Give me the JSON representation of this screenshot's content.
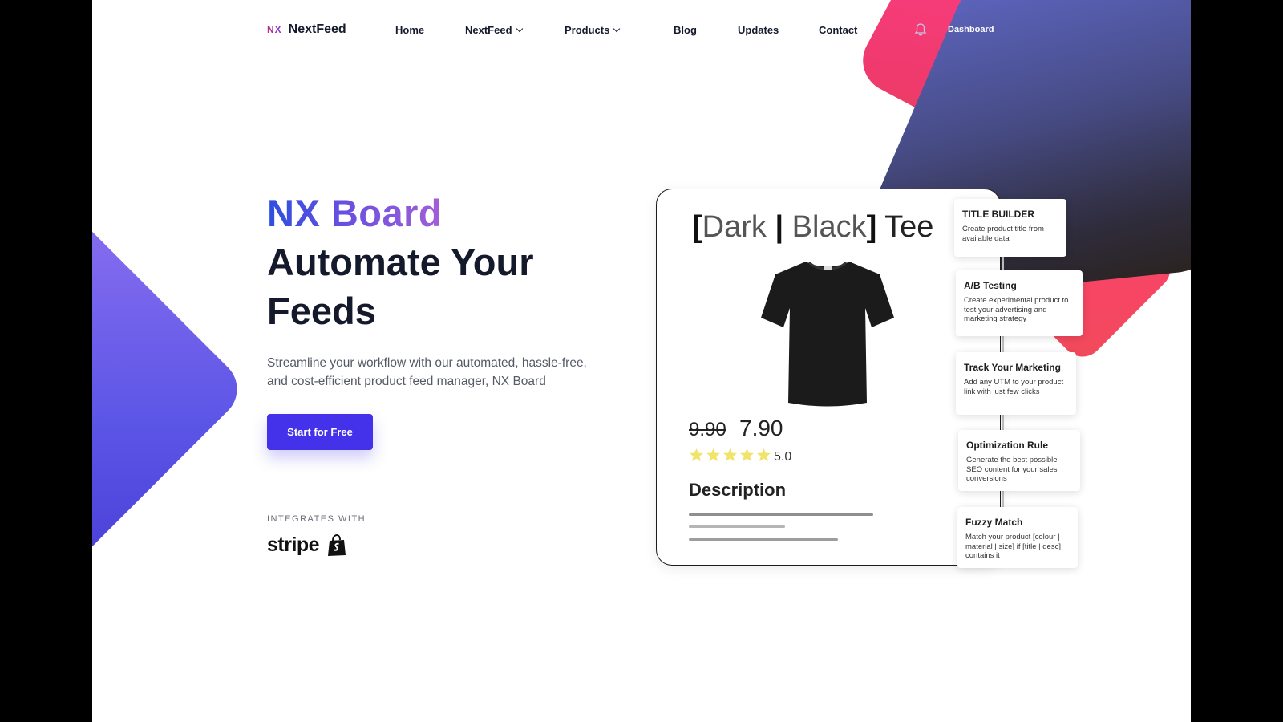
{
  "nav": {
    "logo_mark": "NX",
    "logo_text": "NextFeed",
    "items": [
      {
        "label": "Home"
      },
      {
        "label": "NextFeed"
      },
      {
        "label": "Products"
      },
      {
        "label": "Blog"
      },
      {
        "label": "Updates"
      },
      {
        "label": "Contact"
      }
    ],
    "dashboard_label": "Dashboard"
  },
  "hero": {
    "title_accent": "NX Board",
    "title_main": "Automate Your Feeds",
    "description": "Streamline your workflow with our automated, hassle-free, and cost-efficient product feed manager, NX Board",
    "cta_label": "Start for Free",
    "integrates_label": "INTEGRATES WITH",
    "integrations": [
      {
        "name": "stripe",
        "icon": "stripe-logo"
      },
      {
        "name": "",
        "icon": "shopify-bag-icon"
      }
    ]
  },
  "product_card": {
    "title_part1": "Dark",
    "title_sep": "|",
    "title_part2": "Black",
    "title_part3": "Tee",
    "image_icon": "black-tshirt-image",
    "old_price": "9.90",
    "new_price": "7.90",
    "stars": 5,
    "rating": "5.0",
    "description_heading": "Description"
  },
  "features": [
    {
      "title": "TITLE BUILDER",
      "text": "Create product title from available data"
    },
    {
      "title": "A/B Testing",
      "text": "Create experimental product to test your advertising and marketing strategy"
    },
    {
      "title": "Track Your Marketing",
      "text": "Add any UTM to your product link with just few clicks"
    },
    {
      "title": "Optimization Rule",
      "text": "Generate the best possible SEO content for your sales conversions"
    },
    {
      "title": "Fuzzy Match",
      "text": "Match your product [colour | material | size] if [title | desc] contains it"
    }
  ],
  "colors": {
    "brand_purple": "#4432ea",
    "accent_pink": "#f03a6e",
    "dark_text": "#141a2b",
    "star_yellow": "#f0e46a"
  }
}
